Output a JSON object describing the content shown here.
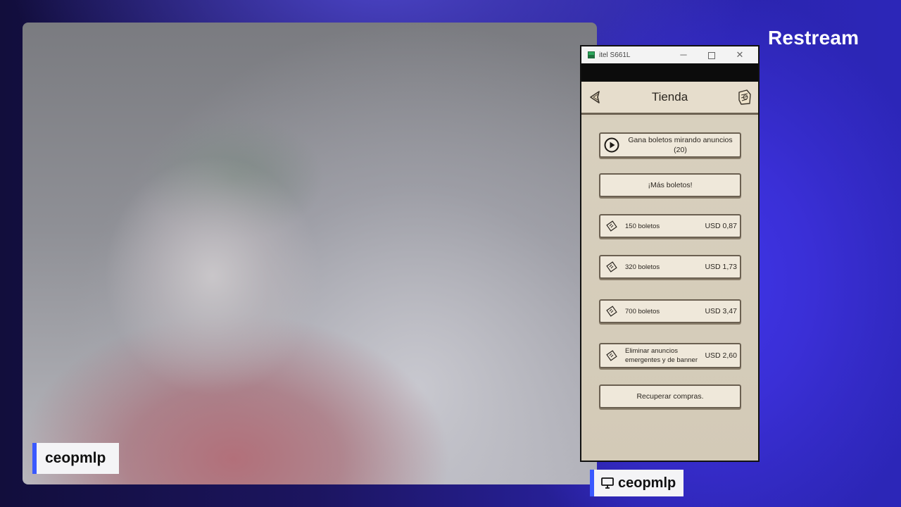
{
  "brand": "Restream",
  "camera": {
    "label": "ceopmlp"
  },
  "window": {
    "title": "itel S661L",
    "buttons": {
      "minimize": "─",
      "close": "✕"
    }
  },
  "store": {
    "title": "Tienda",
    "ads_button": {
      "line1": "Gana boletos mirando anuncios",
      "line2": "(20)"
    },
    "more_tickets": "¡Más boletos!",
    "items": [
      {
        "label": "150 boletos",
        "price": "USD 0,87"
      },
      {
        "label": "320 boletos",
        "price": "USD 1,73"
      },
      {
        "label": "700 boletos",
        "price": "USD 3,47"
      },
      {
        "label_line1": "Eliminar anuncios",
        "label_line2": "emergentes y de banner",
        "price": "USD 2,60"
      }
    ],
    "restore": "Recuperar compras."
  },
  "screen_share": {
    "label": "ceopmlp"
  },
  "colors": {
    "accent": "#3a59ff",
    "panel": "#efe8da",
    "border": "#6b6051"
  }
}
